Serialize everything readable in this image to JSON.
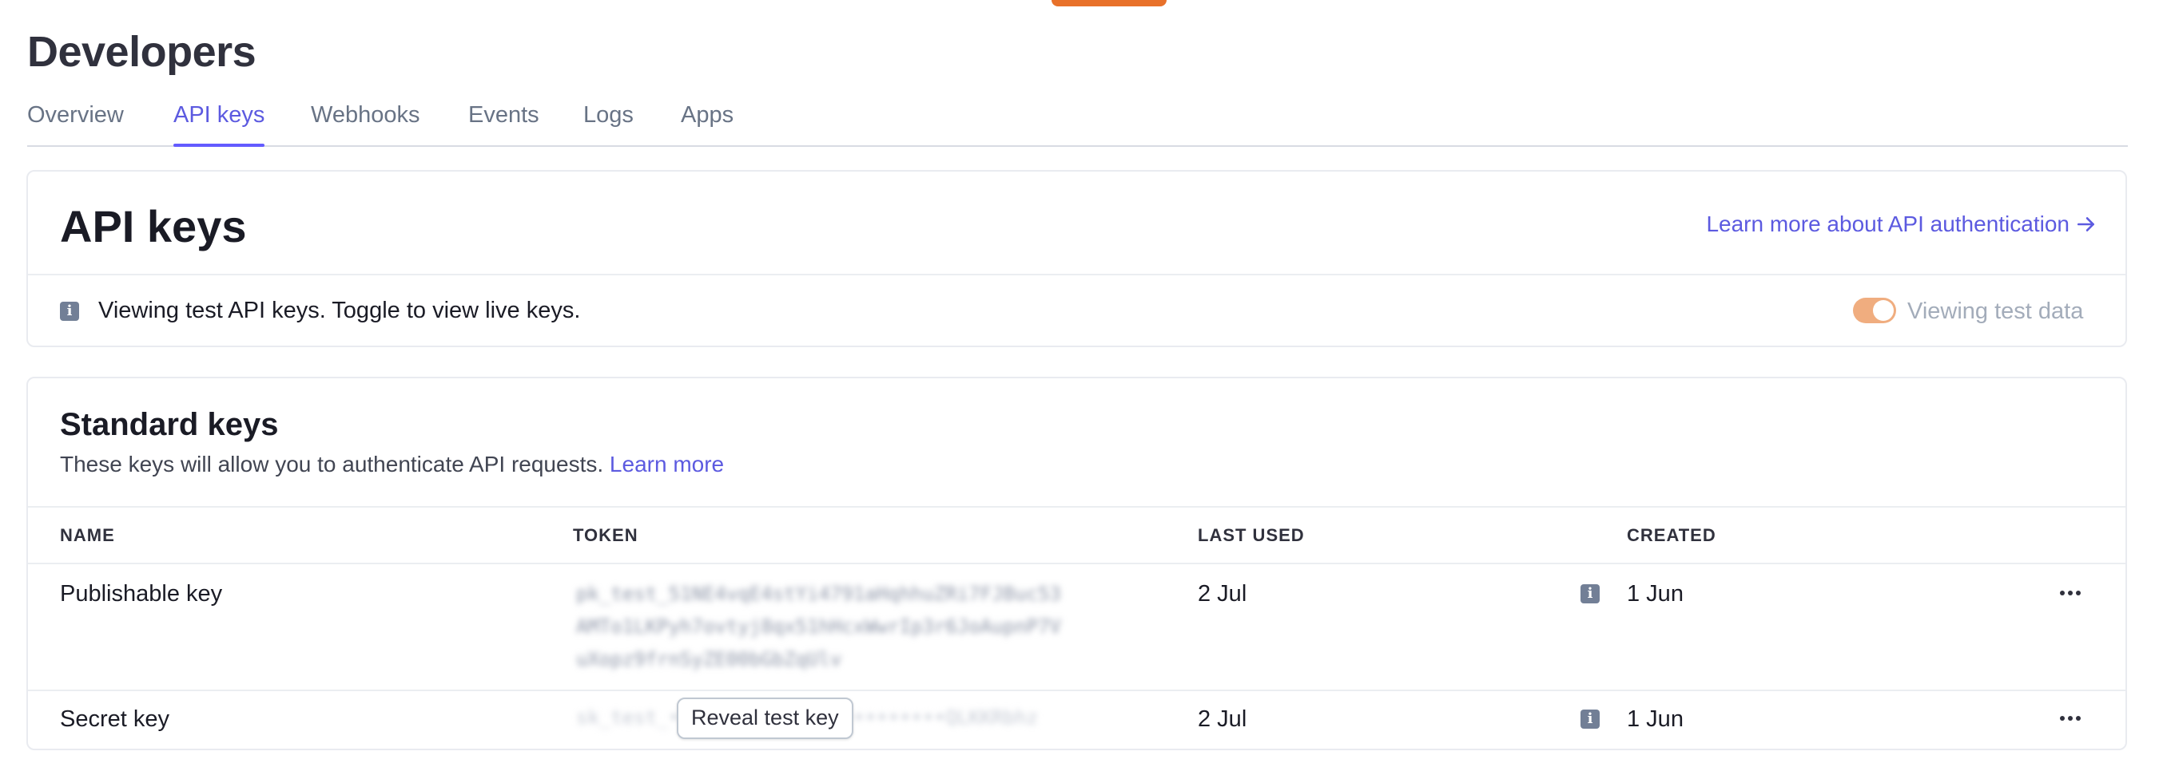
{
  "page": {
    "title": "Developers"
  },
  "tabs": [
    {
      "label": "Overview"
    },
    {
      "label": "API keys",
      "active": true
    },
    {
      "label": "Webhooks"
    },
    {
      "label": "Events"
    },
    {
      "label": "Logs"
    },
    {
      "label": "Apps"
    }
  ],
  "api_keys_card": {
    "title": "API keys",
    "learn_link": "Learn more about API authentication",
    "notice": "Viewing test API keys. Toggle to view live keys.",
    "toggle_label": "Viewing test data"
  },
  "standard_keys": {
    "title": "Standard keys",
    "description": "These keys will allow you to authenticate API requests.",
    "learn_more": "Learn more",
    "columns": {
      "name": "NAME",
      "token": "TOKEN",
      "last_used": "LAST USED",
      "created": "CREATED"
    },
    "rows": [
      {
        "name": "Publishable key",
        "last_used": "2 Jul",
        "created": "1 Jun"
      },
      {
        "name": "Secret key",
        "last_used": "2 Jul",
        "created": "1 Jun",
        "reveal_label": "Reveal test key"
      }
    ]
  },
  "colors": {
    "accent": "#635bff",
    "toggle": "#f0ad7f",
    "badge": "#e8712a"
  }
}
